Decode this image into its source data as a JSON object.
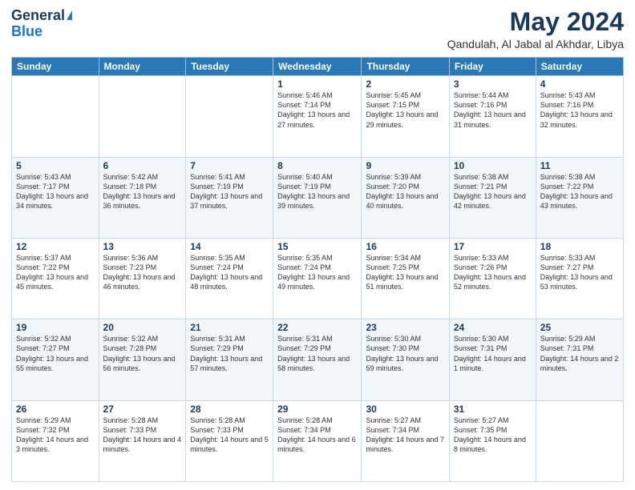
{
  "logo": {
    "general": "General",
    "blue": "Blue"
  },
  "title": {
    "month_year": "May 2024",
    "location": "Qandulah, Al Jabal al Akhdar, Libya"
  },
  "weekdays": [
    "Sunday",
    "Monday",
    "Tuesday",
    "Wednesday",
    "Thursday",
    "Friday",
    "Saturday"
  ],
  "weeks": [
    [
      {
        "day": "",
        "sunrise": "",
        "sunset": "",
        "daylight": ""
      },
      {
        "day": "",
        "sunrise": "",
        "sunset": "",
        "daylight": ""
      },
      {
        "day": "",
        "sunrise": "",
        "sunset": "",
        "daylight": ""
      },
      {
        "day": "1",
        "sunrise": "Sunrise: 5:46 AM",
        "sunset": "Sunset: 7:14 PM",
        "daylight": "Daylight: 13 hours and 27 minutes."
      },
      {
        "day": "2",
        "sunrise": "Sunrise: 5:45 AM",
        "sunset": "Sunset: 7:15 PM",
        "daylight": "Daylight: 13 hours and 29 minutes."
      },
      {
        "day": "3",
        "sunrise": "Sunrise: 5:44 AM",
        "sunset": "Sunset: 7:16 PM",
        "daylight": "Daylight: 13 hours and 31 minutes."
      },
      {
        "day": "4",
        "sunrise": "Sunrise: 5:43 AM",
        "sunset": "Sunset: 7:16 PM",
        "daylight": "Daylight: 13 hours and 32 minutes."
      }
    ],
    [
      {
        "day": "5",
        "sunrise": "Sunrise: 5:43 AM",
        "sunset": "Sunset: 7:17 PM",
        "daylight": "Daylight: 13 hours and 34 minutes."
      },
      {
        "day": "6",
        "sunrise": "Sunrise: 5:42 AM",
        "sunset": "Sunset: 7:18 PM",
        "daylight": "Daylight: 13 hours and 36 minutes."
      },
      {
        "day": "7",
        "sunrise": "Sunrise: 5:41 AM",
        "sunset": "Sunset: 7:19 PM",
        "daylight": "Daylight: 13 hours and 37 minutes."
      },
      {
        "day": "8",
        "sunrise": "Sunrise: 5:40 AM",
        "sunset": "Sunset: 7:19 PM",
        "daylight": "Daylight: 13 hours and 39 minutes."
      },
      {
        "day": "9",
        "sunrise": "Sunrise: 5:39 AM",
        "sunset": "Sunset: 7:20 PM",
        "daylight": "Daylight: 13 hours and 40 minutes."
      },
      {
        "day": "10",
        "sunrise": "Sunrise: 5:38 AM",
        "sunset": "Sunset: 7:21 PM",
        "daylight": "Daylight: 13 hours and 42 minutes."
      },
      {
        "day": "11",
        "sunrise": "Sunrise: 5:38 AM",
        "sunset": "Sunset: 7:22 PM",
        "daylight": "Daylight: 13 hours and 43 minutes."
      }
    ],
    [
      {
        "day": "12",
        "sunrise": "Sunrise: 5:37 AM",
        "sunset": "Sunset: 7:22 PM",
        "daylight": "Daylight: 13 hours and 45 minutes."
      },
      {
        "day": "13",
        "sunrise": "Sunrise: 5:36 AM",
        "sunset": "Sunset: 7:23 PM",
        "daylight": "Daylight: 13 hours and 46 minutes."
      },
      {
        "day": "14",
        "sunrise": "Sunrise: 5:35 AM",
        "sunset": "Sunset: 7:24 PM",
        "daylight": "Daylight: 13 hours and 48 minutes."
      },
      {
        "day": "15",
        "sunrise": "Sunrise: 5:35 AM",
        "sunset": "Sunset: 7:24 PM",
        "daylight": "Daylight: 13 hours and 49 minutes."
      },
      {
        "day": "16",
        "sunrise": "Sunrise: 5:34 AM",
        "sunset": "Sunset: 7:25 PM",
        "daylight": "Daylight: 13 hours and 51 minutes."
      },
      {
        "day": "17",
        "sunrise": "Sunrise: 5:33 AM",
        "sunset": "Sunset: 7:26 PM",
        "daylight": "Daylight: 13 hours and 52 minutes."
      },
      {
        "day": "18",
        "sunrise": "Sunrise: 5:33 AM",
        "sunset": "Sunset: 7:27 PM",
        "daylight": "Daylight: 13 hours and 53 minutes."
      }
    ],
    [
      {
        "day": "19",
        "sunrise": "Sunrise: 5:32 AM",
        "sunset": "Sunset: 7:27 PM",
        "daylight": "Daylight: 13 hours and 55 minutes."
      },
      {
        "day": "20",
        "sunrise": "Sunrise: 5:32 AM",
        "sunset": "Sunset: 7:28 PM",
        "daylight": "Daylight: 13 hours and 56 minutes."
      },
      {
        "day": "21",
        "sunrise": "Sunrise: 5:31 AM",
        "sunset": "Sunset: 7:29 PM",
        "daylight": "Daylight: 13 hours and 57 minutes."
      },
      {
        "day": "22",
        "sunrise": "Sunrise: 5:31 AM",
        "sunset": "Sunset: 7:29 PM",
        "daylight": "Daylight: 13 hours and 58 minutes."
      },
      {
        "day": "23",
        "sunrise": "Sunrise: 5:30 AM",
        "sunset": "Sunset: 7:30 PM",
        "daylight": "Daylight: 13 hours and 59 minutes."
      },
      {
        "day": "24",
        "sunrise": "Sunrise: 5:30 AM",
        "sunset": "Sunset: 7:31 PM",
        "daylight": "Daylight: 14 hours and 1 minute."
      },
      {
        "day": "25",
        "sunrise": "Sunrise: 5:29 AM",
        "sunset": "Sunset: 7:31 PM",
        "daylight": "Daylight: 14 hours and 2 minutes."
      }
    ],
    [
      {
        "day": "26",
        "sunrise": "Sunrise: 5:29 AM",
        "sunset": "Sunset: 7:32 PM",
        "daylight": "Daylight: 14 hours and 3 minutes."
      },
      {
        "day": "27",
        "sunrise": "Sunrise: 5:28 AM",
        "sunset": "Sunset: 7:33 PM",
        "daylight": "Daylight: 14 hours and 4 minutes."
      },
      {
        "day": "28",
        "sunrise": "Sunrise: 5:28 AM",
        "sunset": "Sunset: 7:33 PM",
        "daylight": "Daylight: 14 hours and 5 minutes."
      },
      {
        "day": "29",
        "sunrise": "Sunrise: 5:28 AM",
        "sunset": "Sunset: 7:34 PM",
        "daylight": "Daylight: 14 hours and 6 minutes."
      },
      {
        "day": "30",
        "sunrise": "Sunrise: 5:27 AM",
        "sunset": "Sunset: 7:34 PM",
        "daylight": "Daylight: 14 hours and 7 minutes."
      },
      {
        "day": "31",
        "sunrise": "Sunrise: 5:27 AM",
        "sunset": "Sunset: 7:35 PM",
        "daylight": "Daylight: 14 hours and 8 minutes."
      },
      {
        "day": "",
        "sunrise": "",
        "sunset": "",
        "daylight": ""
      }
    ]
  ]
}
